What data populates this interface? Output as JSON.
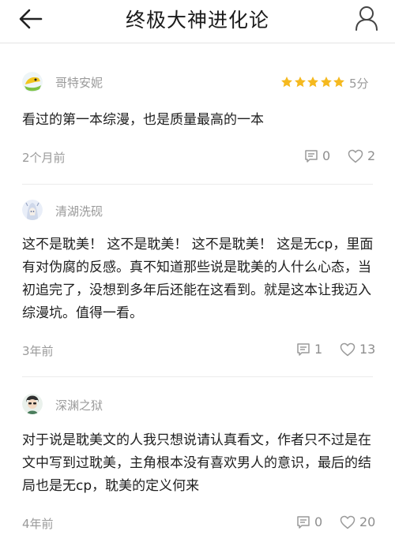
{
  "header": {
    "title": "终极大神进化论",
    "back_icon": "arrow-left-icon",
    "profile_icon": "user-icon"
  },
  "comments": [
    {
      "username": "哥特安妮",
      "rating_stars": 5,
      "rating_text": "5分",
      "text": "看过的第一本综漫，也是质量最高的一本",
      "time": "2个月前",
      "reply_count": "0",
      "like_count": "2"
    },
    {
      "username": "清湖洗砚",
      "text": "这不是耽美！ 这不是耽美！ 这不是耽美！ 这是无cp，里面有对伪腐的反感。真不知道那些说是耽美的人什么心态，当初追完了，没想到多年后还能在这看到。就是这本让我迈入综漫坑。值得一看。",
      "time": "3年前",
      "reply_count": "1",
      "like_count": "13"
    },
    {
      "username": "深渊之狱",
      "text": "对于说是耽美文的人我只想说请认真看文，作者只不过是在文中写到过耽美，主角根本没有喜欢男人的意识，最后的结局也是无cp，耽美的定义何来",
      "time": "4年前",
      "reply_count": "0",
      "like_count": "20"
    }
  ],
  "colors": {
    "star": "#f5b91f",
    "muted_text": "#9a9a9a",
    "body_text": "#1e1e1e"
  }
}
